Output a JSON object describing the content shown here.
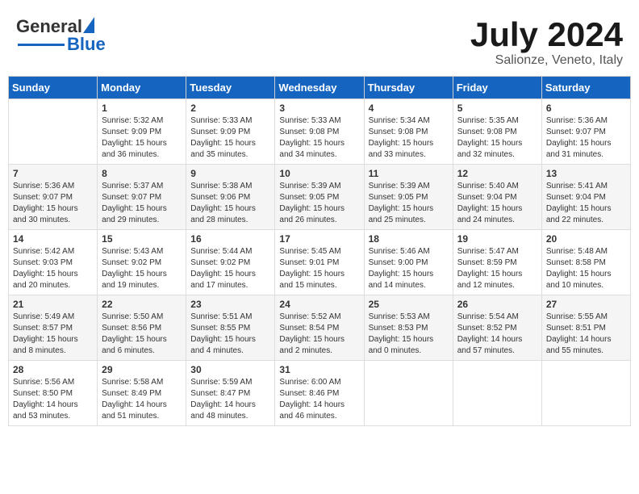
{
  "header": {
    "logo_general": "General",
    "logo_blue": "Blue",
    "month_title": "July 2024",
    "subtitle": "Salionze, Veneto, Italy"
  },
  "weekdays": [
    "Sunday",
    "Monday",
    "Tuesday",
    "Wednesday",
    "Thursday",
    "Friday",
    "Saturday"
  ],
  "weeks": [
    [
      {
        "day": "",
        "sunrise": "",
        "sunset": "",
        "daylight": ""
      },
      {
        "day": "1",
        "sunrise": "Sunrise: 5:32 AM",
        "sunset": "Sunset: 9:09 PM",
        "daylight": "Daylight: 15 hours and 36 minutes."
      },
      {
        "day": "2",
        "sunrise": "Sunrise: 5:33 AM",
        "sunset": "Sunset: 9:09 PM",
        "daylight": "Daylight: 15 hours and 35 minutes."
      },
      {
        "day": "3",
        "sunrise": "Sunrise: 5:33 AM",
        "sunset": "Sunset: 9:08 PM",
        "daylight": "Daylight: 15 hours and 34 minutes."
      },
      {
        "day": "4",
        "sunrise": "Sunrise: 5:34 AM",
        "sunset": "Sunset: 9:08 PM",
        "daylight": "Daylight: 15 hours and 33 minutes."
      },
      {
        "day": "5",
        "sunrise": "Sunrise: 5:35 AM",
        "sunset": "Sunset: 9:08 PM",
        "daylight": "Daylight: 15 hours and 32 minutes."
      },
      {
        "day": "6",
        "sunrise": "Sunrise: 5:36 AM",
        "sunset": "Sunset: 9:07 PM",
        "daylight": "Daylight: 15 hours and 31 minutes."
      }
    ],
    [
      {
        "day": "7",
        "sunrise": "Sunrise: 5:36 AM",
        "sunset": "Sunset: 9:07 PM",
        "daylight": "Daylight: 15 hours and 30 minutes."
      },
      {
        "day": "8",
        "sunrise": "Sunrise: 5:37 AM",
        "sunset": "Sunset: 9:07 PM",
        "daylight": "Daylight: 15 hours and 29 minutes."
      },
      {
        "day": "9",
        "sunrise": "Sunrise: 5:38 AM",
        "sunset": "Sunset: 9:06 PM",
        "daylight": "Daylight: 15 hours and 28 minutes."
      },
      {
        "day": "10",
        "sunrise": "Sunrise: 5:39 AM",
        "sunset": "Sunset: 9:05 PM",
        "daylight": "Daylight: 15 hours and 26 minutes."
      },
      {
        "day": "11",
        "sunrise": "Sunrise: 5:39 AM",
        "sunset": "Sunset: 9:05 PM",
        "daylight": "Daylight: 15 hours and 25 minutes."
      },
      {
        "day": "12",
        "sunrise": "Sunrise: 5:40 AM",
        "sunset": "Sunset: 9:04 PM",
        "daylight": "Daylight: 15 hours and 24 minutes."
      },
      {
        "day": "13",
        "sunrise": "Sunrise: 5:41 AM",
        "sunset": "Sunset: 9:04 PM",
        "daylight": "Daylight: 15 hours and 22 minutes."
      }
    ],
    [
      {
        "day": "14",
        "sunrise": "Sunrise: 5:42 AM",
        "sunset": "Sunset: 9:03 PM",
        "daylight": "Daylight: 15 hours and 20 minutes."
      },
      {
        "day": "15",
        "sunrise": "Sunrise: 5:43 AM",
        "sunset": "Sunset: 9:02 PM",
        "daylight": "Daylight: 15 hours and 19 minutes."
      },
      {
        "day": "16",
        "sunrise": "Sunrise: 5:44 AM",
        "sunset": "Sunset: 9:02 PM",
        "daylight": "Daylight: 15 hours and 17 minutes."
      },
      {
        "day": "17",
        "sunrise": "Sunrise: 5:45 AM",
        "sunset": "Sunset: 9:01 PM",
        "daylight": "Daylight: 15 hours and 15 minutes."
      },
      {
        "day": "18",
        "sunrise": "Sunrise: 5:46 AM",
        "sunset": "Sunset: 9:00 PM",
        "daylight": "Daylight: 15 hours and 14 minutes."
      },
      {
        "day": "19",
        "sunrise": "Sunrise: 5:47 AM",
        "sunset": "Sunset: 8:59 PM",
        "daylight": "Daylight: 15 hours and 12 minutes."
      },
      {
        "day": "20",
        "sunrise": "Sunrise: 5:48 AM",
        "sunset": "Sunset: 8:58 PM",
        "daylight": "Daylight: 15 hours and 10 minutes."
      }
    ],
    [
      {
        "day": "21",
        "sunrise": "Sunrise: 5:49 AM",
        "sunset": "Sunset: 8:57 PM",
        "daylight": "Daylight: 15 hours and 8 minutes."
      },
      {
        "day": "22",
        "sunrise": "Sunrise: 5:50 AM",
        "sunset": "Sunset: 8:56 PM",
        "daylight": "Daylight: 15 hours and 6 minutes."
      },
      {
        "day": "23",
        "sunrise": "Sunrise: 5:51 AM",
        "sunset": "Sunset: 8:55 PM",
        "daylight": "Daylight: 15 hours and 4 minutes."
      },
      {
        "day": "24",
        "sunrise": "Sunrise: 5:52 AM",
        "sunset": "Sunset: 8:54 PM",
        "daylight": "Daylight: 15 hours and 2 minutes."
      },
      {
        "day": "25",
        "sunrise": "Sunrise: 5:53 AM",
        "sunset": "Sunset: 8:53 PM",
        "daylight": "Daylight: 15 hours and 0 minutes."
      },
      {
        "day": "26",
        "sunrise": "Sunrise: 5:54 AM",
        "sunset": "Sunset: 8:52 PM",
        "daylight": "Daylight: 14 hours and 57 minutes."
      },
      {
        "day": "27",
        "sunrise": "Sunrise: 5:55 AM",
        "sunset": "Sunset: 8:51 PM",
        "daylight": "Daylight: 14 hours and 55 minutes."
      }
    ],
    [
      {
        "day": "28",
        "sunrise": "Sunrise: 5:56 AM",
        "sunset": "Sunset: 8:50 PM",
        "daylight": "Daylight: 14 hours and 53 minutes."
      },
      {
        "day": "29",
        "sunrise": "Sunrise: 5:58 AM",
        "sunset": "Sunset: 8:49 PM",
        "daylight": "Daylight: 14 hours and 51 minutes."
      },
      {
        "day": "30",
        "sunrise": "Sunrise: 5:59 AM",
        "sunset": "Sunset: 8:47 PM",
        "daylight": "Daylight: 14 hours and 48 minutes."
      },
      {
        "day": "31",
        "sunrise": "Sunrise: 6:00 AM",
        "sunset": "Sunset: 8:46 PM",
        "daylight": "Daylight: 14 hours and 46 minutes."
      },
      {
        "day": "",
        "sunrise": "",
        "sunset": "",
        "daylight": ""
      },
      {
        "day": "",
        "sunrise": "",
        "sunset": "",
        "daylight": ""
      },
      {
        "day": "",
        "sunrise": "",
        "sunset": "",
        "daylight": ""
      }
    ]
  ]
}
